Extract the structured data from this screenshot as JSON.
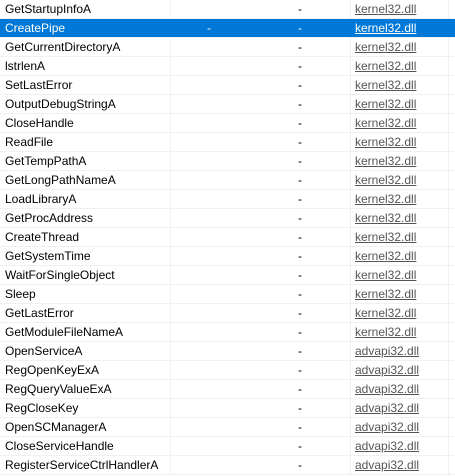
{
  "colors": {
    "selection": "#0078d7",
    "selection_text": "#ffffff",
    "grid_line": "#f0f0f0",
    "link": "#555555"
  },
  "rows": [
    {
      "name": "GetStartupInfoA",
      "ordinal": "",
      "hint": "-",
      "library": "kernel32.dll",
      "selected": false
    },
    {
      "name": "CreatePipe",
      "ordinal": "-",
      "hint": "-",
      "library": "kernel32.dll",
      "selected": true
    },
    {
      "name": "GetCurrentDirectoryA",
      "ordinal": "",
      "hint": "-",
      "library": "kernel32.dll",
      "selected": false
    },
    {
      "name": "lstrlenA",
      "ordinal": "",
      "hint": "-",
      "library": "kernel32.dll",
      "selected": false
    },
    {
      "name": "SetLastError",
      "ordinal": "",
      "hint": "-",
      "library": "kernel32.dll",
      "selected": false
    },
    {
      "name": "OutputDebugStringA",
      "ordinal": "",
      "hint": "-",
      "library": "kernel32.dll",
      "selected": false
    },
    {
      "name": "CloseHandle",
      "ordinal": "",
      "hint": "-",
      "library": "kernel32.dll",
      "selected": false
    },
    {
      "name": "ReadFile",
      "ordinal": "",
      "hint": "-",
      "library": "kernel32.dll",
      "selected": false
    },
    {
      "name": "GetTempPathA",
      "ordinal": "",
      "hint": "-",
      "library": "kernel32.dll",
      "selected": false
    },
    {
      "name": "GetLongPathNameA",
      "ordinal": "",
      "hint": "-",
      "library": "kernel32.dll",
      "selected": false
    },
    {
      "name": "LoadLibraryA",
      "ordinal": "",
      "hint": "-",
      "library": "kernel32.dll",
      "selected": false
    },
    {
      "name": "GetProcAddress",
      "ordinal": "",
      "hint": "-",
      "library": "kernel32.dll",
      "selected": false
    },
    {
      "name": "CreateThread",
      "ordinal": "",
      "hint": "-",
      "library": "kernel32.dll",
      "selected": false
    },
    {
      "name": "GetSystemTime",
      "ordinal": "",
      "hint": "-",
      "library": "kernel32.dll",
      "selected": false
    },
    {
      "name": "WaitForSingleObject",
      "ordinal": "",
      "hint": "-",
      "library": "kernel32.dll",
      "selected": false
    },
    {
      "name": "Sleep",
      "ordinal": "",
      "hint": "-",
      "library": "kernel32.dll",
      "selected": false
    },
    {
      "name": "GetLastError",
      "ordinal": "",
      "hint": "-",
      "library": "kernel32.dll",
      "selected": false
    },
    {
      "name": "GetModuleFileNameA",
      "ordinal": "",
      "hint": "-",
      "library": "kernel32.dll",
      "selected": false
    },
    {
      "name": "OpenServiceA",
      "ordinal": "",
      "hint": "-",
      "library": "advapi32.dll",
      "selected": false
    },
    {
      "name": "RegOpenKeyExA",
      "ordinal": "",
      "hint": "-",
      "library": "advapi32.dll",
      "selected": false
    },
    {
      "name": "RegQueryValueExA",
      "ordinal": "",
      "hint": "-",
      "library": "advapi32.dll",
      "selected": false
    },
    {
      "name": "RegCloseKey",
      "ordinal": "",
      "hint": "-",
      "library": "advapi32.dll",
      "selected": false
    },
    {
      "name": "OpenSCManagerA",
      "ordinal": "",
      "hint": "-",
      "library": "advapi32.dll",
      "selected": false
    },
    {
      "name": "CloseServiceHandle",
      "ordinal": "",
      "hint": "-",
      "library": "advapi32.dll",
      "selected": false
    },
    {
      "name": "RegisterServiceCtrlHandlerA",
      "ordinal": "",
      "hint": "-",
      "library": "advapi32.dll",
      "selected": false
    }
  ]
}
